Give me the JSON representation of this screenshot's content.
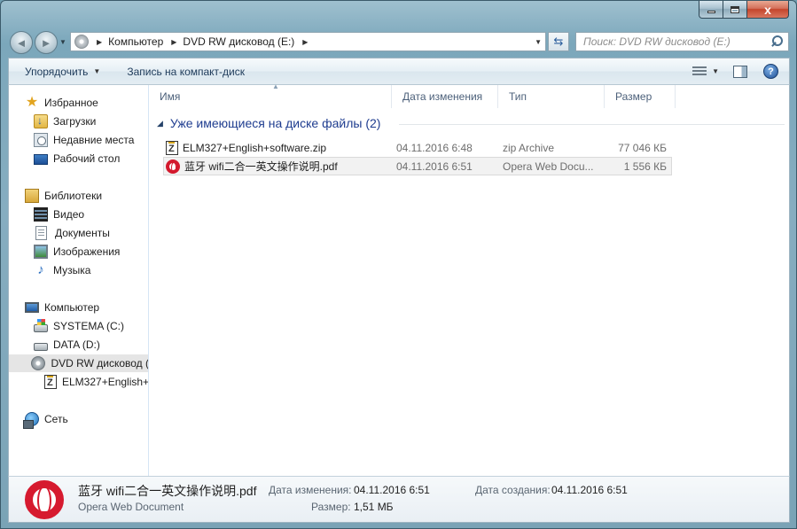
{
  "window": {
    "minimize_icon": "minimize-icon",
    "maximize_icon": "maximize-icon",
    "close_label": "x"
  },
  "nav": {
    "back_label": "◄",
    "forward_label": "►",
    "breadcrumbs": [
      "Компьютер",
      "DVD RW дисковод (E:)"
    ],
    "search_placeholder": "Поиск: DVD RW дисковод (E:)"
  },
  "toolbar": {
    "organize_label": "Упорядочить",
    "burn_label": "Запись на компакт-диск"
  },
  "sidebar": {
    "favorites": {
      "label": "Избранное",
      "items": [
        "Загрузки",
        "Недавние места",
        "Рабочий стол"
      ]
    },
    "libraries": {
      "label": "Библиотеки",
      "items": [
        "Видео",
        "Документы",
        "Изображения",
        "Музыка"
      ]
    },
    "computer": {
      "label": "Компьютер",
      "items": [
        "SYSTEMA (C:)",
        "DATA (D:)",
        "DVD RW дисковод (",
        "ELM327+English+"
      ]
    },
    "network": {
      "label": "Сеть"
    }
  },
  "columns": [
    "Имя",
    "Дата изменения",
    "Тип",
    "Размер"
  ],
  "group": {
    "title": "Уже имеющиеся на диске файлы (2)"
  },
  "files": [
    {
      "name": "ELM327+English+software.zip",
      "date": "04.11.2016 6:48",
      "type": "zip Archive",
      "size": "77 046 КБ",
      "icon": "zip-icon"
    },
    {
      "name": "蓝牙 wifi二合一英文操作说明.pdf",
      "date": "04.11.2016 6:51",
      "type": "Opera Web Docu...",
      "size": "1 556 КБ",
      "icon": "opera-icon"
    }
  ],
  "details": {
    "name": "蓝牙 wifi二合一英文操作说明.pdf",
    "type": "Opera Web Document",
    "modified_label": "Дата изменения:",
    "modified_value": "04.11.2016 6:51",
    "created_label": "Дата создания:",
    "created_value": "04.11.2016 6:51",
    "size_label": "Размер:",
    "size_value": "1,51 МБ"
  }
}
